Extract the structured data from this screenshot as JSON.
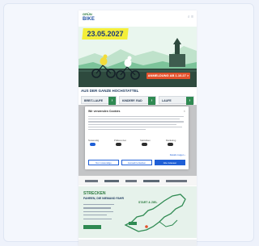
{
  "hero": {
    "date": "23.05.2027",
    "cta": "ANMELDUNG AB 1.10.27 >"
  },
  "section": {
    "title": "AUS DER GANZE HOCHSTATTEL",
    "pills": [
      "BREIT-LAUFE",
      "KINDERF. RAD",
      "LAUFE"
    ]
  },
  "consent": {
    "title": "Wir verwenden Cookies",
    "toggles": [
      "Notwendig",
      "Präferenzen",
      "Statistiken",
      "Marketing"
    ],
    "details_link": "Details zeigen ›",
    "buttons": [
      "Nur notwendige",
      "Auswahl erlauben",
      "Alle zulassen"
    ]
  },
  "map": {
    "title": "STRECKEN",
    "subtitle": "FAHREN, DIE NIEMAND FAHR",
    "marker": "START & ZIEL"
  },
  "colors": {
    "accent_green": "#2f8a52",
    "date_yellow": "#f4ee38",
    "cta_orange": "#e2522d",
    "consent_blue": "#1f5fd6"
  }
}
